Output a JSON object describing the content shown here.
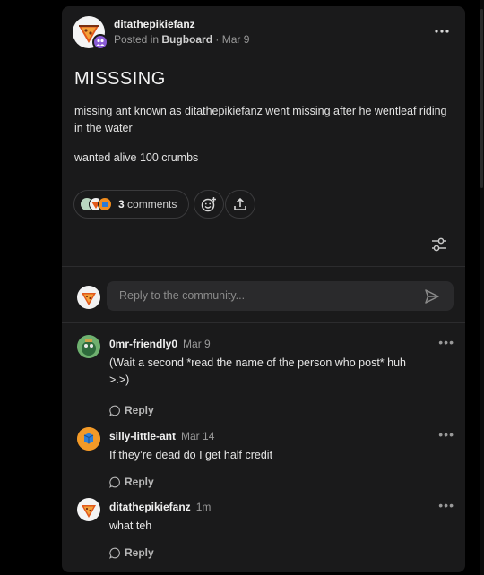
{
  "post": {
    "author": "ditathepikiefanz",
    "posted_prefix": "Posted in ",
    "community": "Bugboard",
    "separator": " · ",
    "date": "Mar 9",
    "title": "MISSSING",
    "body_1": "missing  ant known as ditathepikiefanz went missing after he wentleaf riding in the water",
    "body_2": "wanted alive 100 crumbs",
    "comment_count": "3",
    "comments_label": " comments",
    "more_icon": "more-horizontal-icon"
  },
  "reply": {
    "placeholder": "Reply to the community..."
  },
  "comments": [
    {
      "author": "0mr-friendly0",
      "date": "Mar 9",
      "text": "(Wait a second *read the name of the person who post* huh >.>)",
      "reply_label": "Reply"
    },
    {
      "author": "silly-little-ant",
      "date": "Mar 14",
      "text": "If they’re dead do I get half credit",
      "reply_label": "Reply"
    },
    {
      "author": "ditathepikiefanz",
      "date": "1m",
      "text": "what teh",
      "reply_label": "Reply"
    }
  ],
  "colors": {
    "background": "#000000",
    "card": "#1a1a1b",
    "community_badge": "#8a5bd6",
    "orange_avatar": "#f08c1e",
    "green_avatar": "#3a8a4a"
  }
}
